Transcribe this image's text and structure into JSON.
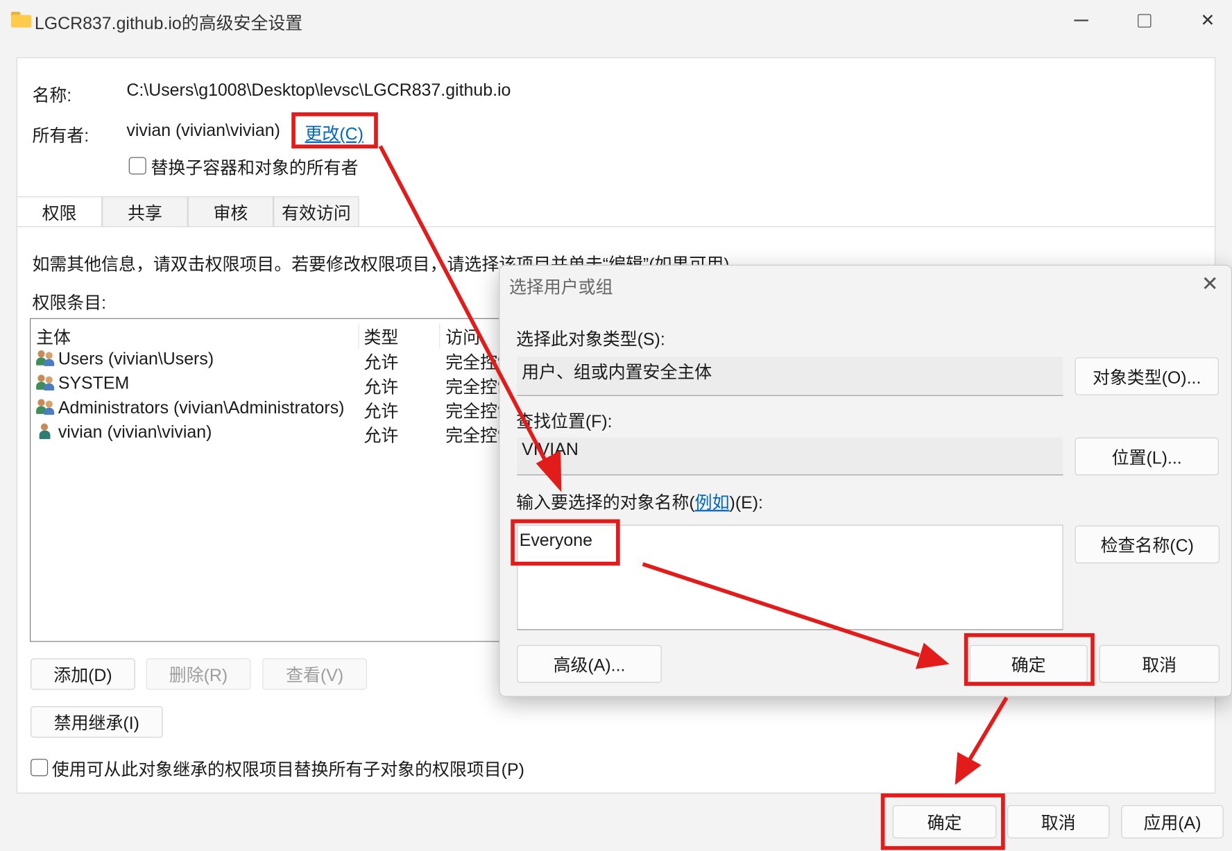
{
  "window": {
    "title": "LGCR837.github.io的高级安全设置",
    "min_icon": "minimize-icon",
    "max_icon": "maximize-icon",
    "close_icon": "close-icon",
    "close_glyph": "✕"
  },
  "header": {
    "name_label": "名称:",
    "name_value": "C:\\Users\\g1008\\Desktop\\levsc\\LGCR837.github.io",
    "owner_label": "所有者:",
    "owner_value": "vivian (vivian\\vivian)",
    "change_link": "更改(C)",
    "replace_owner_checkbox": "替换子容器和对象的所有者"
  },
  "tabs": [
    "权限",
    "共享",
    "审核",
    "有效访问"
  ],
  "permissions": {
    "info_text": "如需其他信息，请双击权限项目。若要修改权限项目，请选择该项目并单击“编辑”(如果可用)。",
    "entries_label": "权限条目:",
    "columns": [
      "主体",
      "类型",
      "访问"
    ],
    "rows": [
      {
        "principal": "Users (vivian\\Users)",
        "type": "允许",
        "access": "完全控制",
        "icon": "group-icon"
      },
      {
        "principal": "SYSTEM",
        "type": "允许",
        "access": "完全控制",
        "icon": "group-icon"
      },
      {
        "principal": "Administrators (vivian\\Administrators)",
        "type": "允许",
        "access": "完全控制",
        "icon": "group-icon"
      },
      {
        "principal": "vivian (vivian\\vivian)",
        "type": "允许",
        "access": "完全控制",
        "icon": "user-icon"
      }
    ],
    "add_button": "添加(D)",
    "remove_button": "删除(R)",
    "view_button": "查看(V)",
    "disable_inheritance_button": "禁用继承(I)",
    "replace_child_checkbox": "使用可从此对象继承的权限项目替换所有子对象的权限项目(P)"
  },
  "footer": {
    "ok": "确定",
    "cancel": "取消",
    "apply": "应用(A)"
  },
  "dialog": {
    "title": "选择用户或组",
    "object_type_label": "选择此对象类型(S):",
    "object_type_value": "用户、组或内置安全主体",
    "object_types_button": "对象类型(O)...",
    "location_label": "查找位置(F):",
    "location_value": "VIVIAN",
    "locations_button": "位置(L)...",
    "enter_names_label_pre": "输入要选择的对象名称(",
    "enter_names_link": "例如",
    "enter_names_label_post": ")(E):",
    "names_value": "Everyone",
    "check_names_button": "检查名称(C)",
    "advanced_button": "高级(A)...",
    "ok": "确定",
    "cancel": "取消"
  },
  "annotation_color": "#e21b1b"
}
